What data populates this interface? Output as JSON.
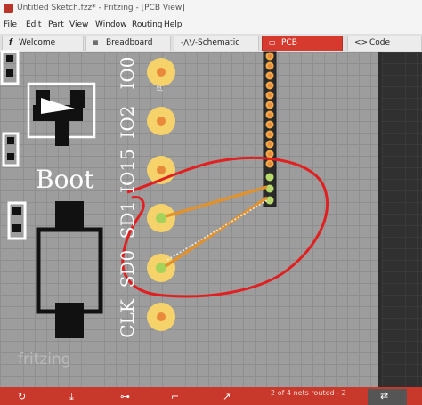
{
  "window": {
    "title": "Untitled Sketch.fzz* - Fritzing - [PCB View]"
  },
  "menu": [
    "File",
    "Edit",
    "Part",
    "View",
    "Window",
    "Routing",
    "Help"
  ],
  "tabs": [
    {
      "label": "Welcome",
      "icon": "fritzing-icon",
      "active": false
    },
    {
      "label": "Breadboard",
      "icon": "breadboard-icon",
      "active": false
    },
    {
      "label": "Schematic",
      "icon": "schematic-icon",
      "active": false
    },
    {
      "label": "PCB",
      "icon": "pcb-icon",
      "active": true
    },
    {
      "label": "Code",
      "icon": "code-icon",
      "active": false
    }
  ],
  "pcb": {
    "boot_label": "Boot",
    "pin_labels": [
      "IO0",
      "IO2",
      "IO15",
      "SD1",
      "SD0",
      "CLK"
    ],
    "part_label": "J2",
    "watermark": "fritzing",
    "colors": {
      "board": "#9d9d9d",
      "pad": "#f5d26a",
      "pad_center": "#e8893b",
      "trace": "#e0922f",
      "annotation": "#e02020",
      "silkscreen": "#ffffff"
    }
  },
  "statusbar": {
    "routing_status": "2 of 4 nets routed - 2",
    "icons": [
      "rotate-icon",
      "export-icon",
      "route-icon",
      "autoroute-icon",
      "share-icon",
      "routing-status-icon"
    ]
  }
}
